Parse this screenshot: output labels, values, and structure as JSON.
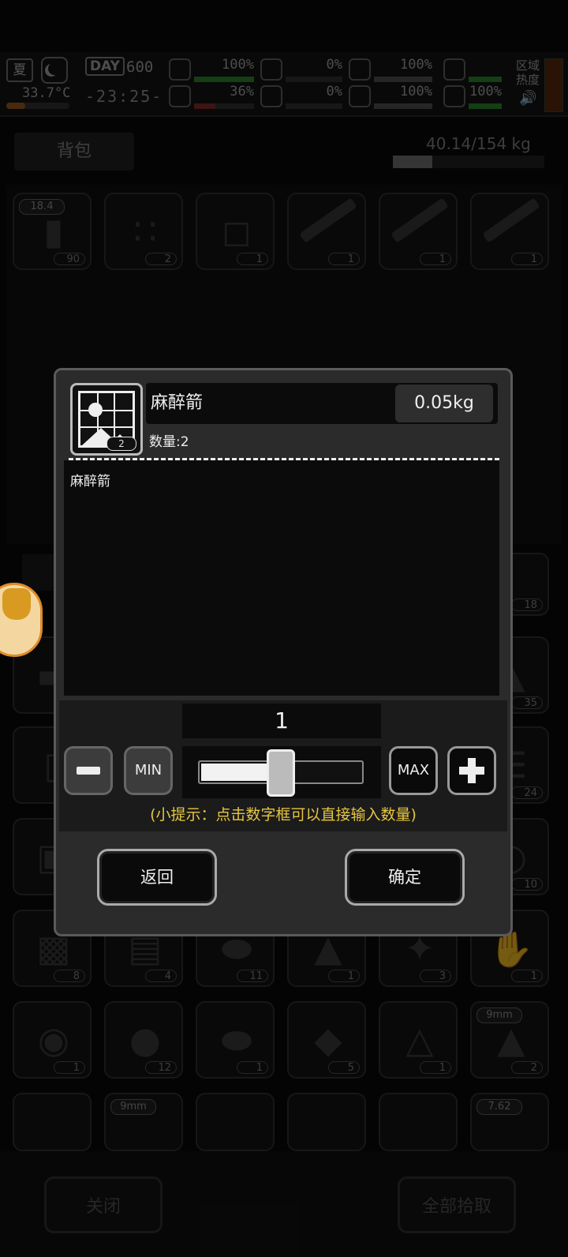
{
  "hud": {
    "season": "夏",
    "temperature": "33.7°C",
    "day_label": "DAY",
    "day_number": "600",
    "clock": "-23:25-",
    "stats": [
      {
        "icon": "medkit-icon",
        "value": "100%",
        "level": 1.0,
        "color": "#2e8a2e"
      },
      {
        "icon": "stomach-icon",
        "value": "0%",
        "level": 0.0,
        "color": "#8a2e2e"
      },
      {
        "icon": "bladder-icon",
        "value": "100%",
        "level": 1.0,
        "color": "#555555"
      },
      {
        "icon": "toilet-icon",
        "value": "100%",
        "level": 1.0,
        "color": "#2e8a2e"
      },
      {
        "icon": "brain-icon",
        "value": "36%",
        "level": 0.36,
        "color": "#8a2e2e"
      },
      {
        "icon": "blood-icon",
        "value": "0%",
        "level": 0.0,
        "color": "#8a2e2e"
      },
      {
        "icon": "heart-icon",
        "value": "100%",
        "level": 1.0,
        "color": "#555555"
      },
      {
        "icon": "energy-icon",
        "value": "100%",
        "level": 1.0,
        "color": "#2e8a2e"
      }
    ],
    "zone_label_1": "区域",
    "zone_label_2": "热度"
  },
  "backpack": {
    "tab_label": "背包",
    "weight": "40.14/154 kg",
    "weight_fraction": 0.26,
    "slots": [
      {
        "tag": "18.4",
        "count": "90",
        "icon": "shotgun-shell-icon"
      },
      {
        "tag": "",
        "count": "2",
        "icon": "pellets-icon"
      },
      {
        "tag": "",
        "count": "1",
        "icon": "beaker-icon"
      },
      {
        "tag": "",
        "count": "1",
        "icon": "shotgun-icon"
      },
      {
        "tag": "",
        "count": "1",
        "icon": "shotgun-icon"
      },
      {
        "tag": "",
        "count": "1",
        "icon": "shotgun-icon"
      }
    ]
  },
  "ground": {
    "right_counts": [
      "18",
      "35",
      "24",
      "10"
    ],
    "row5": [
      {
        "count": "8",
        "tag": ""
      },
      {
        "count": "4",
        "tag": ""
      },
      {
        "count": "11",
        "tag": ""
      },
      {
        "count": "1",
        "tag": ""
      },
      {
        "count": "3",
        "tag": ""
      },
      {
        "count": "1",
        "tag": ""
      }
    ],
    "row6": [
      {
        "count": "1",
        "tag": ""
      },
      {
        "count": "12",
        "tag": ""
      },
      {
        "count": "1",
        "tag": ""
      },
      {
        "count": "5",
        "tag": ""
      },
      {
        "count": "1",
        "tag": ""
      },
      {
        "count": "2",
        "tag": "9mm"
      }
    ],
    "row7_tags": [
      "9mm",
      "7.62"
    ]
  },
  "bottom": {
    "close_label": "关闭",
    "pickup_all_label": "全部拾取"
  },
  "dialog": {
    "item_name": "麻醉箭",
    "item_weight": "0.05kg",
    "icon_qty": "2",
    "quantity_line": "数量:2",
    "description": "麻醉箭",
    "selected_count": "1",
    "slider_fraction": 0.5,
    "min_label": "MIN",
    "max_label": "MAX",
    "hint": "(小提示：点击数字框可以直接输入数量)",
    "back_label": "返回",
    "confirm_label": "确定"
  }
}
